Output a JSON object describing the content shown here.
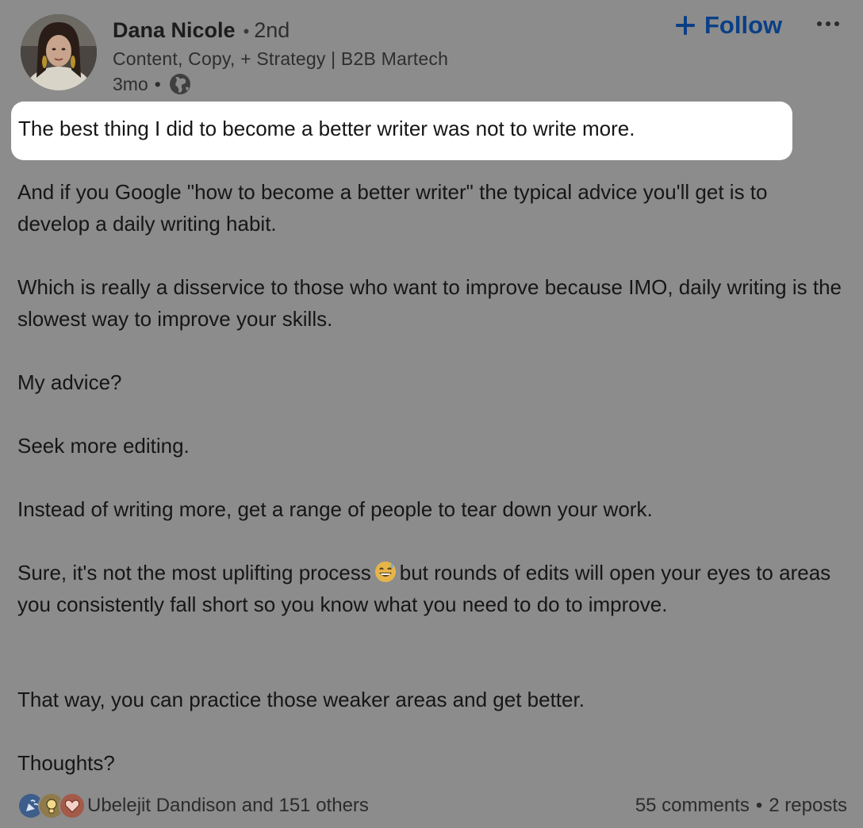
{
  "author": {
    "name": "Dana Nicole",
    "degree": "2nd",
    "headline": "Content, Copy, + Strategy | B2B Martech",
    "time": "3mo",
    "visibility_icon": "globe-icon"
  },
  "actions": {
    "follow_label": "Follow",
    "follow_icon": "plus-icon",
    "more_icon": "more-icon"
  },
  "post": {
    "highlight": "The best thing I did to become a better writer was not to write more.",
    "paragraphs": [
      "And if you Google \"how to become a better writer\" the typical advice you'll get is to develop a daily writing habit.",
      "Which is really a disservice to those who want to improve because IMO, daily writing is the slowest way to improve your skills.",
      "My advice?",
      "Seek more editing.",
      "Instead of writing more, get a range of people to tear down your work."
    ],
    "para_sure_before": "Sure, it's not the most uplifting process",
    "para_sure_emoji": "grinning-sweat-emoji",
    "para_sure_after": "but rounds of edits will open your eyes to areas you consistently fall short so you know what you need to do to improve.",
    "para_that_way": "That way, you can practice those weaker areas and get better.",
    "para_thoughts": "Thoughts?"
  },
  "footer": {
    "reaction_icons": [
      "celebrate-icon",
      "insightful-icon",
      "love-icon"
    ],
    "reactions_text": "Ubelejit Dandison and 151 others",
    "comments": "55 comments",
    "separator": "•",
    "reposts": "2 reposts"
  },
  "colors": {
    "overlay": "#8c8c8c",
    "follow": "#0a3f86",
    "highlight_bg": "#ffffff"
  }
}
